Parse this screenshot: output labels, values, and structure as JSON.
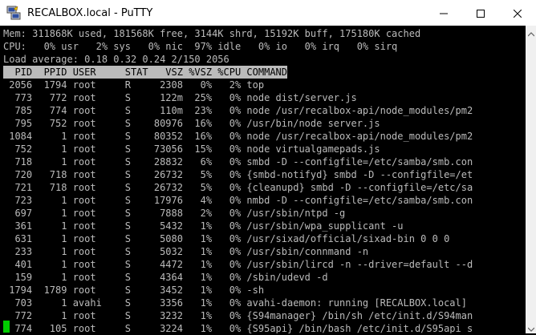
{
  "window": {
    "title": "RECALBOX.local - PuTTY"
  },
  "terminal": {
    "summary": [
      "Mem: 311868K used, 181568K free, 3144K shrd, 15192K buff, 175180K cached",
      "CPU:   0% usr   2% sys   0% nic  97% idle   0% io   0% irq   0% sirq",
      "Load average: 0.18 0.32 0.24 2/150 2056"
    ],
    "header": "  PID  PPID USER     STAT   VSZ %VSZ %CPU COMMAND",
    "processes": [
      " 2056  1794 root     R     2308   0%   2% top",
      "  773   772 root     S     122m  25%   0% node dist/server.js",
      "  785   774 root     S     110m  23%   0% node /usr/recalbox-api/node_modules/pm2",
      "  795   752 root     S    80976  16%   0% /usr/bin/node server.js",
      " 1084     1 root     S    80352  16%   0% node /usr/recalbox-api/node_modules/pm2",
      "  752     1 root     S    73056  15%   0% node virtualgamepads.js",
      "  718     1 root     S    28832   6%   0% smbd -D --configfile=/etc/samba/smb.con",
      "  720   718 root     S    26732   5%   0% {smbd-notifyd} smbd -D --configfile=/et",
      "  721   718 root     S    26732   5%   0% {cleanupd} smbd -D --configfile=/etc/sa",
      "  723     1 root     S    17976   4%   0% nmbd -D --configfile=/etc/samba/smb.con",
      "  697     1 root     S     7888   2%   0% /usr/sbin/ntpd -g",
      "  361     1 root     S     5432   1%   0% /usr/sbin/wpa_supplicant -u",
      "  631     1 root     S     5080   1%   0% /usr/sixad/official/sixad-bin 0 0 0",
      "  233     1 root     S     5032   1%   0% /usr/sbin/connmand -n",
      "  401     1 root     S     4472   1%   0% /usr/sbin/lircd -n --driver=default --d",
      "  159     1 root     S     4364   1%   0% /sbin/udevd -d",
      " 1794  1789 root     S     3452   1%   0% -sh",
      "  703     1 avahi    S     3356   1%   0% avahi-daemon: running [RECALBOX.local]",
      "  772     1 root     S     3232   1%   0% {S94manager} /bin/sh /etc/init.d/S94man",
      "  774   105 root     S     3224   1%   0% {S95api} /bin/bash /etc/init.d/S95api s"
    ]
  },
  "icons": {
    "app": "putty-icon",
    "minimize": "minimize-icon",
    "maximize": "maximize-icon",
    "close": "close-icon"
  }
}
